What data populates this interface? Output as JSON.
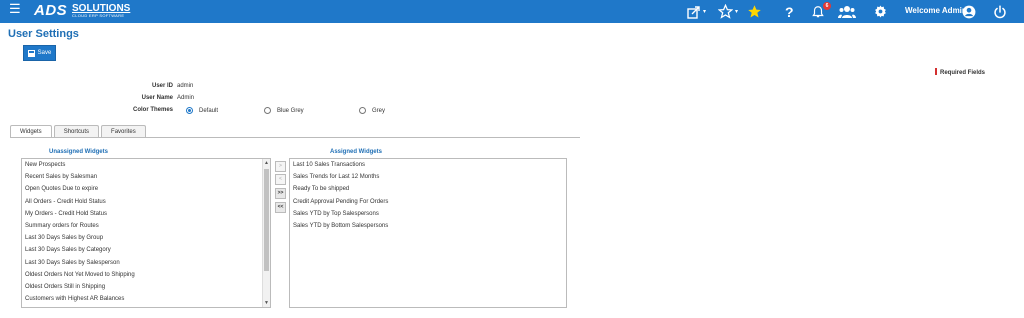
{
  "header": {
    "logo_main": "ADS",
    "logo_brand": "SOLUTIONS",
    "logo_sub": "CLOUD ERP SOFTWARE",
    "notification_count": "6",
    "welcome_text": "Welcome Admin",
    "bg_color": "#1f78c9",
    "icons": [
      "menu-icon",
      "share-icon",
      "star-outline-icon",
      "star-filled-icon",
      "help-icon",
      "bell-icon",
      "users-icon",
      "gear-icon",
      "user-circle-icon",
      "power-icon"
    ]
  },
  "page": {
    "title": "User Settings",
    "save_label": "Save",
    "required_label": "Required Fields"
  },
  "form": {
    "user_id_label": "User ID",
    "user_id_value": "admin",
    "user_name_label": "User Name",
    "user_name_value": "Admin",
    "color_themes_label": "Color Themes",
    "themes": [
      {
        "label": "Default",
        "selected": true
      },
      {
        "label": "Blue Grey",
        "selected": false
      },
      {
        "label": "Grey",
        "selected": false
      }
    ]
  },
  "tabs": [
    "Widgets",
    "Shortcuts",
    "Favorites"
  ],
  "widgets": {
    "unassigned_title": "Unassigned Widgets",
    "assigned_title": "Assigned Widgets",
    "unassigned": [
      "New Prospects",
      "Recent Sales by Salesman",
      "Open Quotes Due to expire",
      "All Orders - Credit Hold Status",
      "My Orders - Credit Hold Status",
      "Summary orders for Routes",
      "Last 30 Days Sales by Group",
      "Last 30 Days Sales by Category",
      "Last 30 Days Sales by Salesperson",
      "Oldest Orders Not Yet Moved to Shipping",
      "Oldest Orders Still in Shipping",
      "Customers with Highest AR Balances"
    ],
    "assigned": [
      "Last 10 Sales Transactions",
      "Sales Trends for Last 12 Months",
      "Ready To be shipped",
      "Credit Approval Pending For Orders",
      "Sales YTD by Top Salespersons",
      "Sales YTD by Bottom Salespersons"
    ],
    "move_buttons": [
      ">",
      "<",
      ">>",
      "<<"
    ]
  }
}
